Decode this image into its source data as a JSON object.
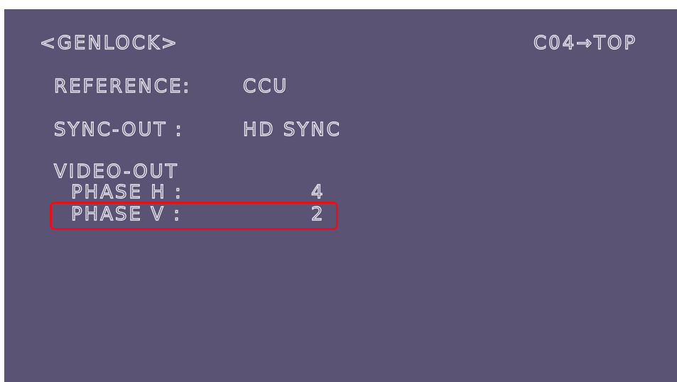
{
  "menu": {
    "title": "<GENLOCK>",
    "page_indicator": "C04→TOP"
  },
  "settings": {
    "reference": {
      "label": "REFERENCE:",
      "value": "CCU"
    },
    "sync_out": {
      "label": "SYNC-OUT :",
      "value": "HD SYNC"
    },
    "video_out": {
      "label": "VIDEO-OUT",
      "phase_h": {
        "label": "PHASE H :",
        "value": "4"
      },
      "phase_v": {
        "label": "PHASE V :",
        "value": "2"
      }
    }
  },
  "colors": {
    "screen_background": "#5a5374",
    "text_outline": "#eae7f1",
    "highlight_box": "#e8101a"
  }
}
